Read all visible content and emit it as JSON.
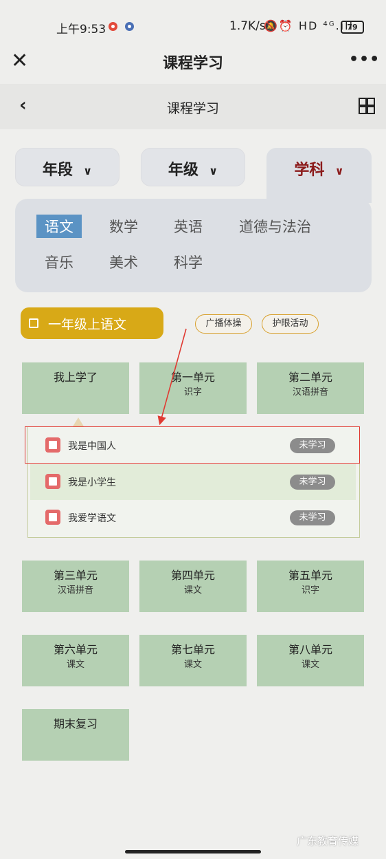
{
  "status_bar": {
    "time": "上午9:53",
    "speed": "1.7K/s",
    "icons": "🔕⏰ HD ⁴ᴳ.ıll",
    "battery": "79"
  },
  "app_header": {
    "title": "课程学习",
    "close_icon": "close-icon",
    "more_icon": "more-icon"
  },
  "page_header": {
    "title": "课程学习",
    "back_icon": "chevron-left-icon",
    "grid_icon": "grid-icon"
  },
  "filters": [
    {
      "label": "年段",
      "chevron": "∨"
    },
    {
      "label": "年级",
      "chevron": "∨"
    },
    {
      "label": "学科",
      "chevron": "∨"
    }
  ],
  "subjects": [
    "语文",
    "数学",
    "英语",
    "道德与法治",
    "音乐",
    "美术",
    "科学"
  ],
  "selected_subject": "语文",
  "grade": {
    "label": "一年级上语文"
  },
  "tags": [
    "广播体操",
    "护眼活动"
  ],
  "units": [
    {
      "title": "我上学了",
      "subtitle": ""
    },
    {
      "title": "第一单元",
      "subtitle": "识字"
    },
    {
      "title": "第二单元",
      "subtitle": "汉语拼音"
    },
    {
      "title": "第三单元",
      "subtitle": "汉语拼音"
    },
    {
      "title": "第四单元",
      "subtitle": "课文"
    },
    {
      "title": "第五单元",
      "subtitle": "识字"
    },
    {
      "title": "第六单元",
      "subtitle": "课文"
    },
    {
      "title": "第七单元",
      "subtitle": "课文"
    },
    {
      "title": "第八单元",
      "subtitle": "课文"
    },
    {
      "title": "期末复习",
      "subtitle": ""
    }
  ],
  "lessons": [
    {
      "title": "我是中国人",
      "status": "未学习"
    },
    {
      "title": "我是小学生",
      "status": "未学习"
    },
    {
      "title": "我爱学语文",
      "status": "未学习"
    }
  ],
  "watermark": "广东教育传媒",
  "colors": {
    "unit_bg": "#b5d0b3",
    "grade_bg": "#d8a917",
    "active_filter": "#8b1a1a",
    "subject_active_bg": "#5b93c4",
    "annotation_red": "#e03a32"
  }
}
